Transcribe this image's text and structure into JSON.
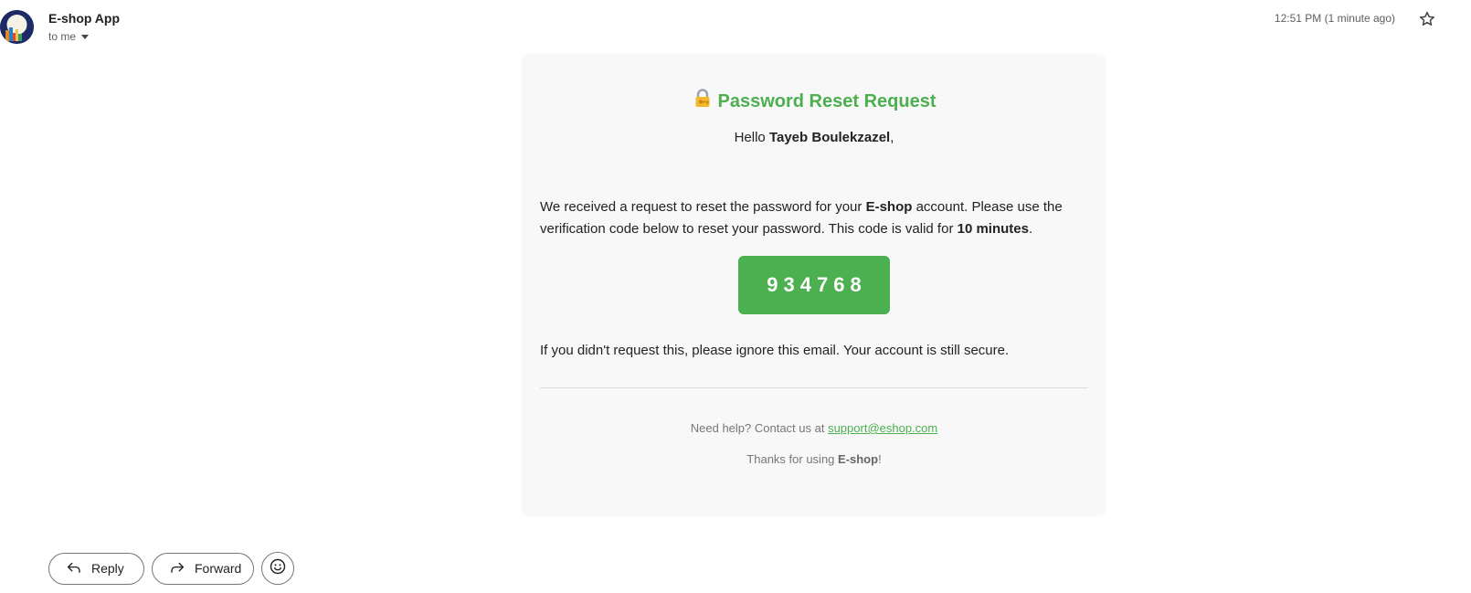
{
  "header": {
    "sender_name": "E-shop App",
    "recipient_label": "to me",
    "timestamp": "12:51 PM (1 minute ago)"
  },
  "email": {
    "title": "Password Reset Request",
    "greeting_prefix": "Hello ",
    "recipient_name": "Tayeb Boulekzazel",
    "greeting_suffix": ",",
    "body_part1": "We received a request to reset the password for your ",
    "body_brand": "E-shop",
    "body_part2": " account. Please use the verification code below to reset your password. This code is valid for ",
    "body_validity": "10 minutes",
    "body_part3": ".",
    "verification_code": "934768",
    "ignore_text": "If you didn't request this, please ignore this email. Your account is still secure.",
    "help_prefix": "Need help? Contact us at ",
    "support_email": "support@eshop.com",
    "thanks_prefix": "Thanks for using ",
    "thanks_brand": "E-shop",
    "thanks_suffix": "!"
  },
  "actions": {
    "reply_label": "Reply",
    "forward_label": "Forward"
  },
  "icons": {
    "title_icon": "lock-with-key-icon",
    "reply_icon": "reply-arrow-icon",
    "forward_icon": "forward-arrow-icon",
    "emoji_icon": "smiley-icon",
    "star_icon": "star-icon",
    "caret_icon": "caret-down-icon"
  },
  "colors": {
    "accent_green": "#4caf50",
    "card_background": "#f8f8f8"
  }
}
